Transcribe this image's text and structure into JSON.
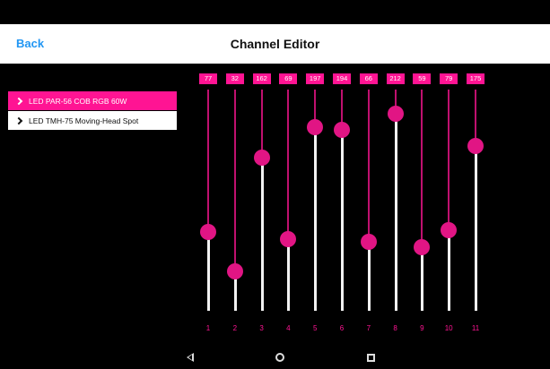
{
  "header": {
    "back_label": "Back",
    "title": "Channel Editor"
  },
  "devices": [
    {
      "label": "LED PAR-56 COB RGB 60W",
      "selected": true
    },
    {
      "label": "LED TMH-75 Moving-Head Spot",
      "selected": false
    }
  ],
  "channels": [
    {
      "number": "1",
      "value": "77"
    },
    {
      "number": "2",
      "value": "32"
    },
    {
      "number": "3",
      "value": "162"
    },
    {
      "number": "4",
      "value": "69"
    },
    {
      "number": "5",
      "value": "197"
    },
    {
      "number": "6",
      "value": "194"
    },
    {
      "number": "7",
      "value": "66"
    },
    {
      "number": "8",
      "value": "212"
    },
    {
      "number": "9",
      "value": "59"
    },
    {
      "number": "10",
      "value": "79"
    },
    {
      "number": "11",
      "value": "175"
    }
  ],
  "slider_max": 255,
  "colors": {
    "accent": "#ff1493",
    "link": "#2196f3",
    "background": "#000000"
  },
  "nav": {
    "back_icon": "back-triangle-icon",
    "home_icon": "home-circle-icon",
    "recents_icon": "recents-square-icon"
  }
}
